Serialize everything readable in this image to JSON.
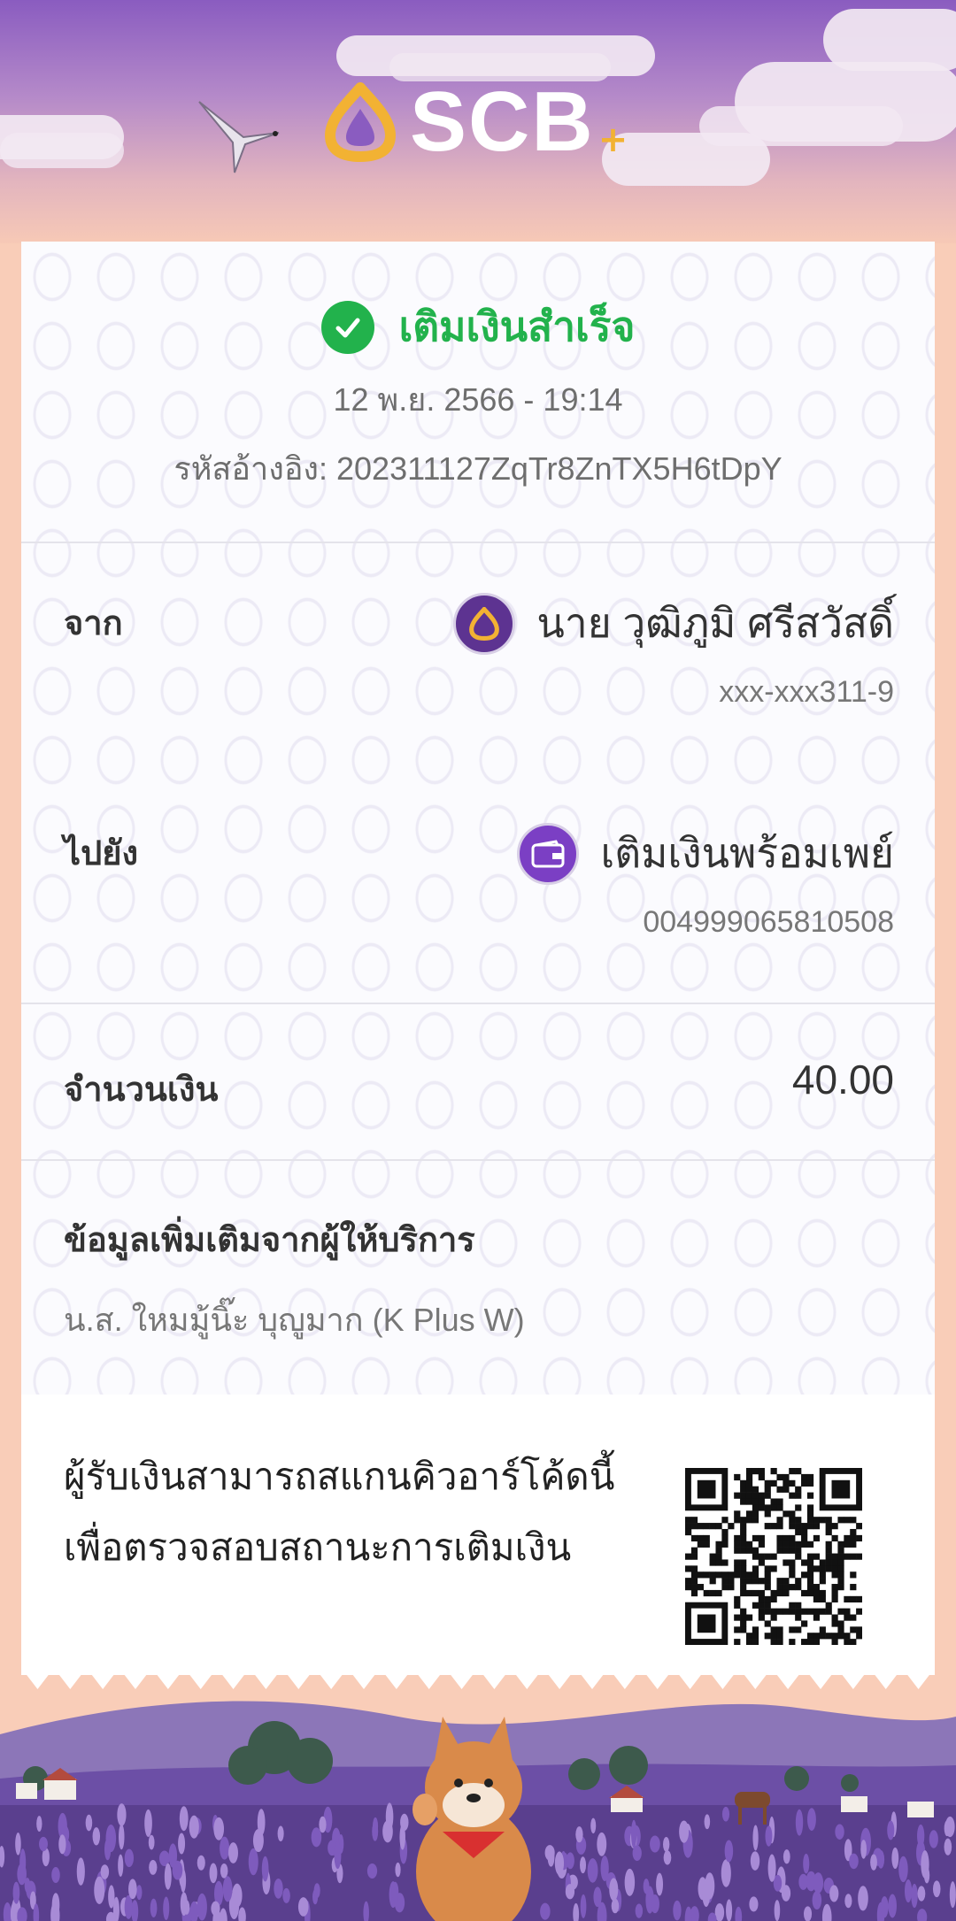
{
  "brand": {
    "name": "SCB",
    "plus": "+"
  },
  "status": {
    "text": "เติมเงินสำเร็จ",
    "color": "#22b24c"
  },
  "datetime": "12 พ.ย. 2566 - 19:14",
  "reference": "รหัสอ้างอิง: 202311127ZqTr8ZnTX5H6tDpY",
  "from": {
    "label": "จาก",
    "name": "นาย วุฒิภูมิ ศรีสวัสดิ์",
    "account": "xxx-xxx311-9"
  },
  "to": {
    "label": "ไปยัง",
    "name": "เติมเงินพร้อมเพย์",
    "account": "004999065810508"
  },
  "amount": {
    "label": "จำนวนเงิน",
    "value": "40.00"
  },
  "info": {
    "title": "ข้อมูลเพิ่มเติมจากผู้ให้บริการ",
    "value": "น.ส. ใหมมู้นิ๊ะ บุญูมาก (K Plus W)"
  },
  "qr_note": {
    "line1": "ผู้รับเงินสามารถสแกนคิวอาร์โค้ดนี้",
    "line2": "เพื่อตรวจสอบสถานะการเติมเงิน"
  },
  "colors": {
    "brand_purple": "#5d3391",
    "success_green": "#22b24c",
    "gold": "#f2b233"
  }
}
